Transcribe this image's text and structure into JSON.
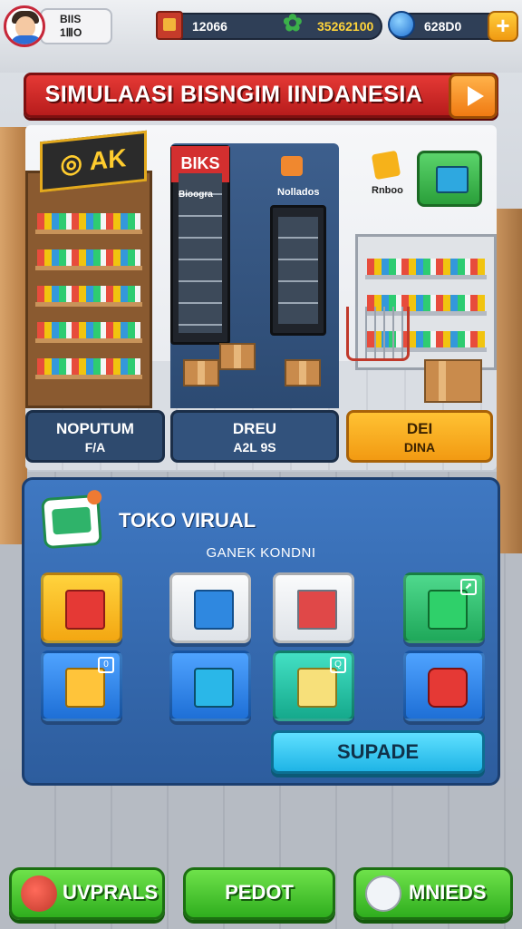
{
  "player": {
    "line1": "BIIS",
    "line2": "1ⅢO"
  },
  "resources": {
    "crates": "12066",
    "leaves": "35262100",
    "gems": "628D0"
  },
  "banner": {
    "title": "SIMULAASI BISNGIM IINDANESIA"
  },
  "scene": {
    "shelf_sign": "AK",
    "fridge_sign": "BIKS",
    "fridge_label": "Bioogra",
    "fridge2_label": "Nollados",
    "corner_label": "Rnboo"
  },
  "categories": [
    {
      "title": "NOPUTUM",
      "sub": "F/A"
    },
    {
      "title": "DREU",
      "sub": "A2L  9S"
    },
    {
      "title": "DEI",
      "sub": "DINA"
    }
  ],
  "panel": {
    "title": "TOKO VIRUAL",
    "subtitle": "GANEK KONDNI",
    "update_label": "SUPADE"
  },
  "nav": {
    "left": "UVPRALS",
    "center": "PEDOT",
    "right": "MNIEDS"
  },
  "colors": {
    "banner": "#d32f2f",
    "panel": "#3468b0",
    "nav": "#3fbf2c",
    "update": "#2ec4ef"
  }
}
